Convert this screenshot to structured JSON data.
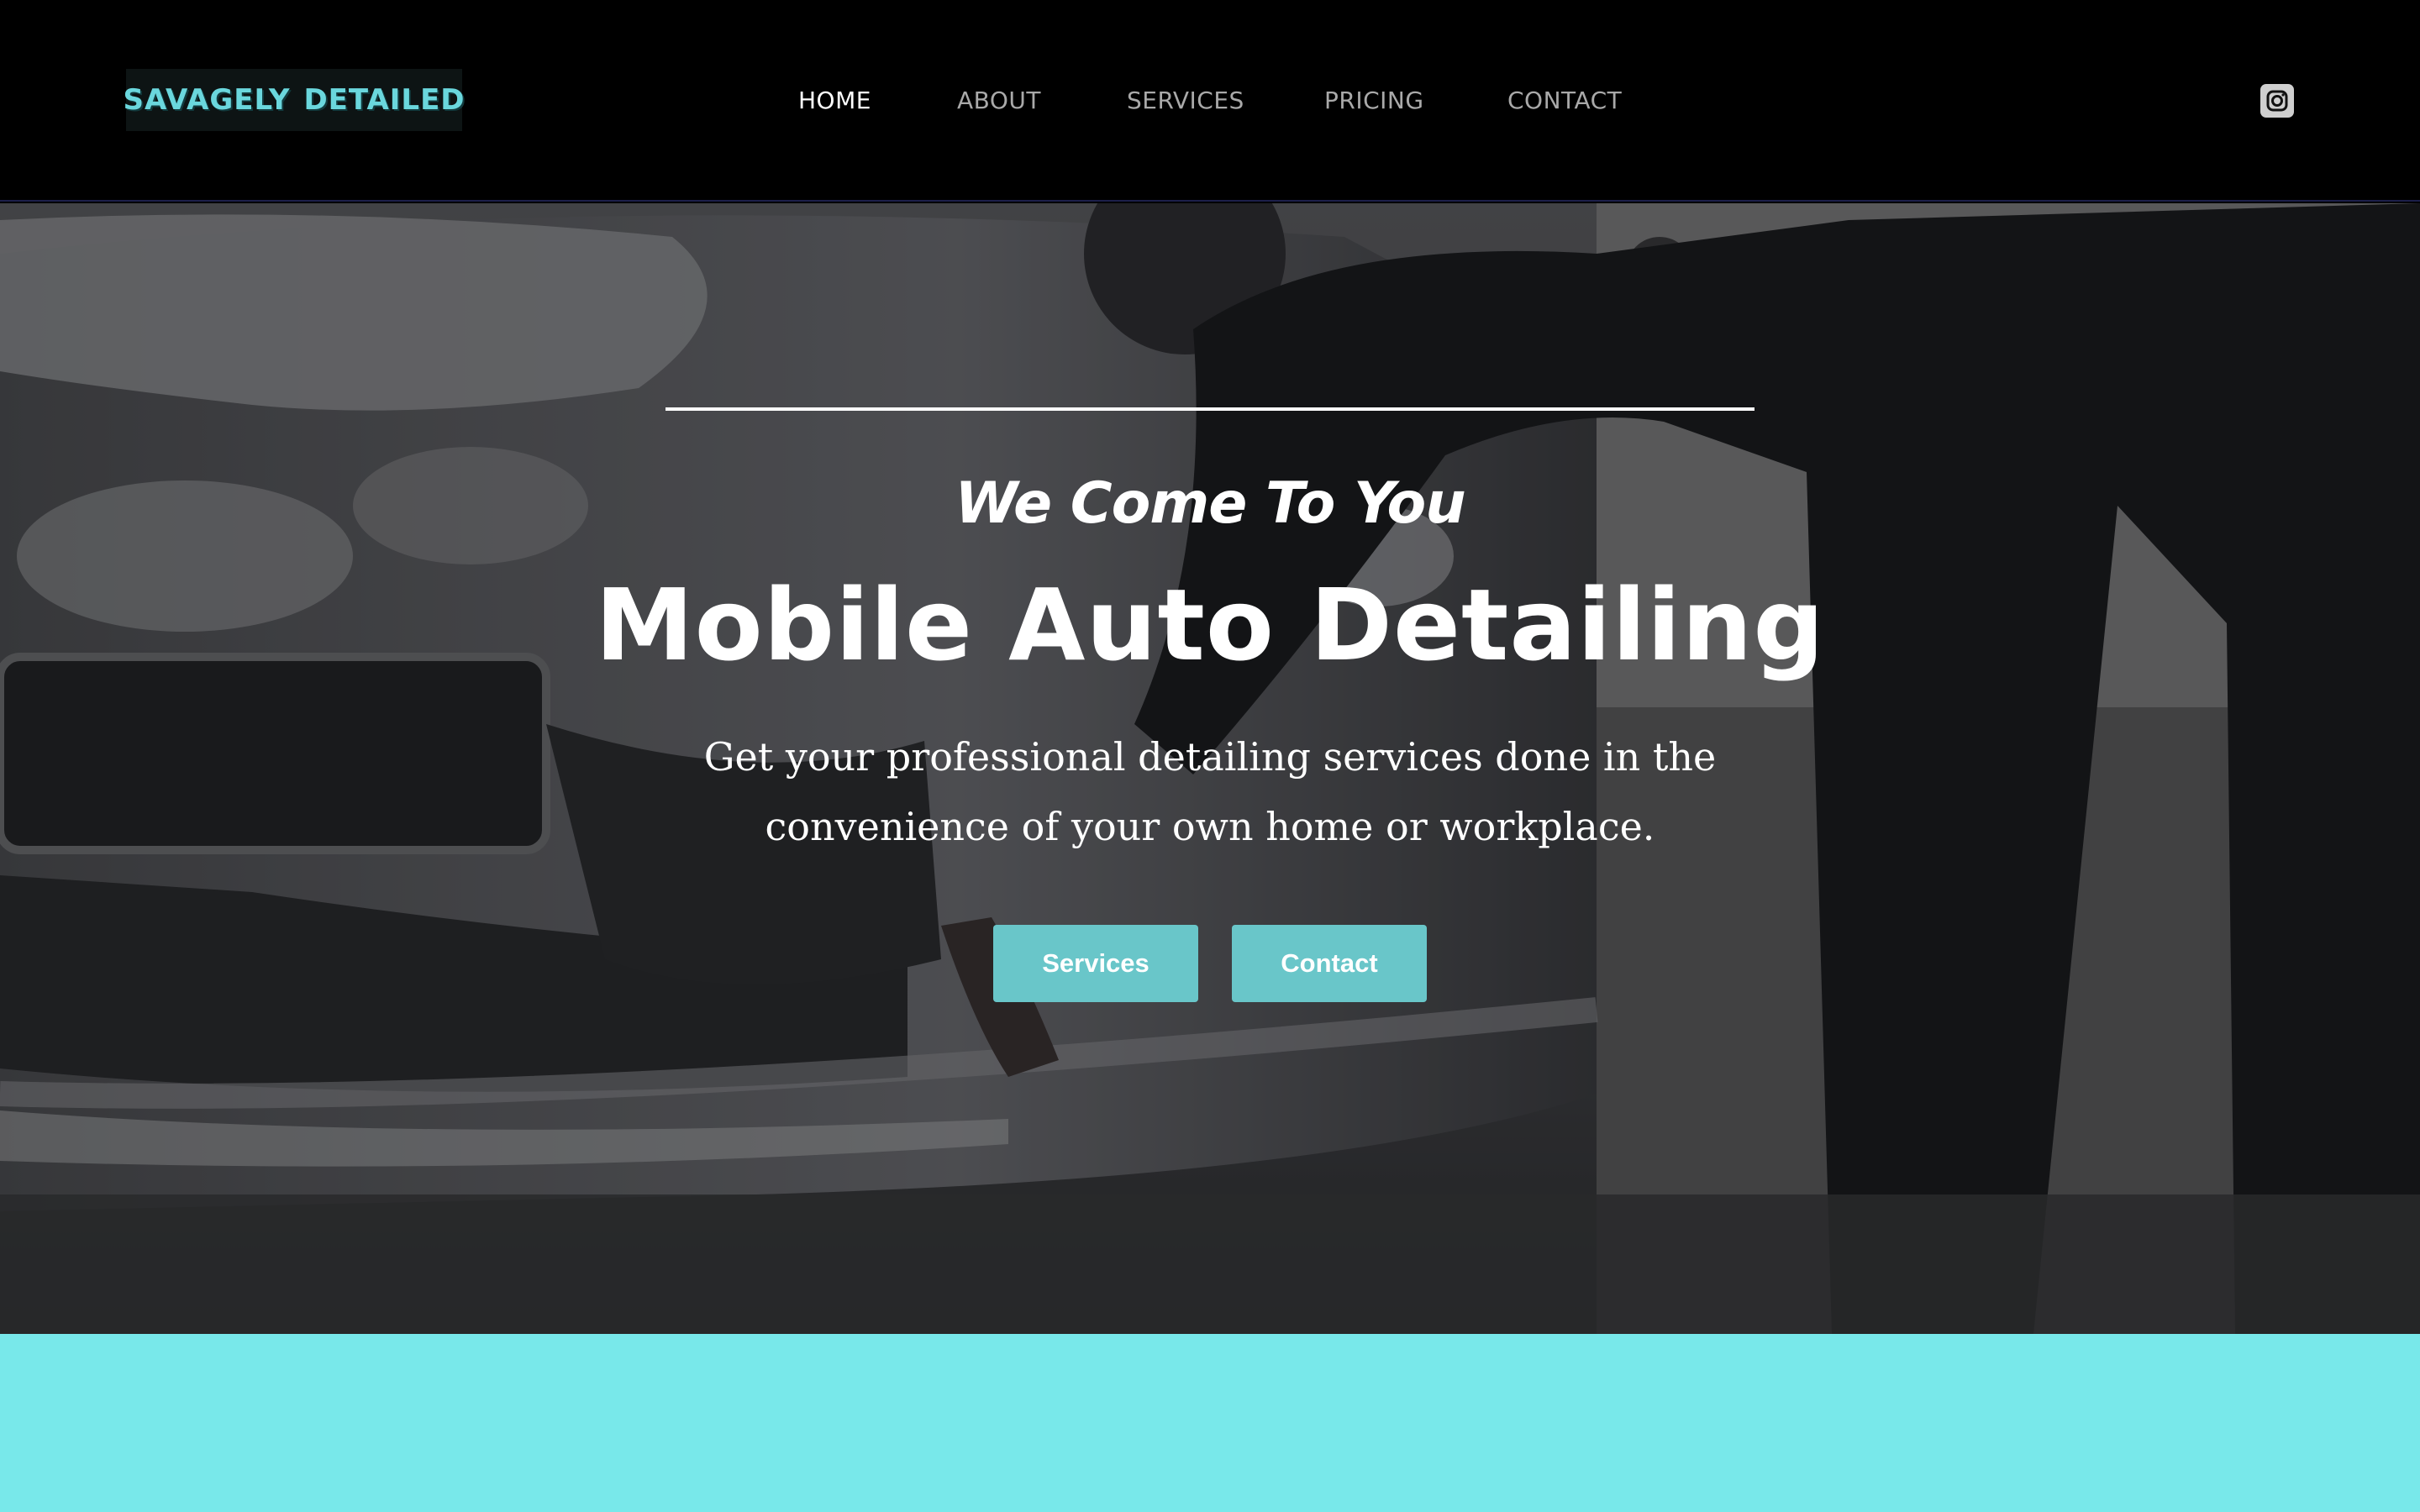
{
  "header": {
    "logo": {
      "word_left": "SAVAGELY",
      "word_right": "DETAILED",
      "icon": "skull-icon"
    },
    "nav": {
      "home": "HOME",
      "about": "ABOUT",
      "services": "SERVICES",
      "pricing": "PRICING",
      "contact": "CONTACT",
      "active": "HOME"
    },
    "social": {
      "icon": "instagram-icon"
    }
  },
  "hero": {
    "tagline": "We Come To You",
    "headline": "Mobile Auto Detailing",
    "subtext": "Get your professional detailing services done in the convenience of your own home or workplace.",
    "buttons": {
      "services": "Services",
      "contact": "Contact"
    },
    "background": "car-wash-photo"
  },
  "colors": {
    "accent": "#69c6c9",
    "section_teal": "#78e8ea",
    "header_bg": "#000000",
    "logo_teal": "#6ad7dd"
  }
}
